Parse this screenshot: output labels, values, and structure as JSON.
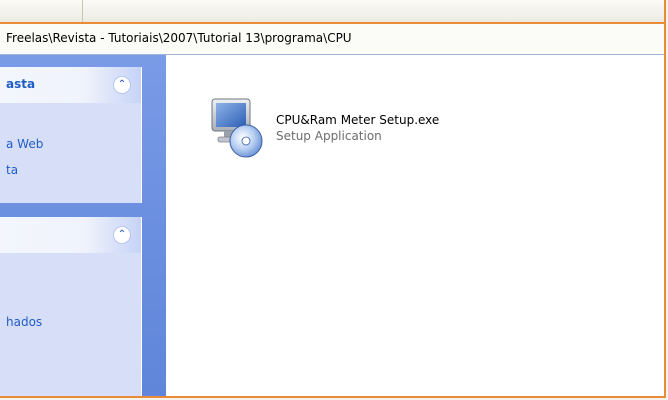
{
  "window": {
    "address_path": "Freelas\\Revista - Tutoriais\\2007\\Tutorial 13\\programa\\CPU"
  },
  "sidebar": {
    "panels": [
      {
        "title": "asta",
        "links": [
          "a Web",
          "ta"
        ]
      },
      {
        "title": "",
        "links": [
          "hados"
        ]
      }
    ],
    "collapse_glyph": "⌃"
  },
  "main": {
    "files": [
      {
        "name": "CPU&Ram Meter Setup.exe",
        "type": "Setup Application",
        "icon": "setup-computer-cd-icon"
      }
    ]
  },
  "colors": {
    "frame_border": "#e88c3a",
    "sidebar_blue": "#6b8fe0",
    "link_blue": "#215dc6"
  }
}
